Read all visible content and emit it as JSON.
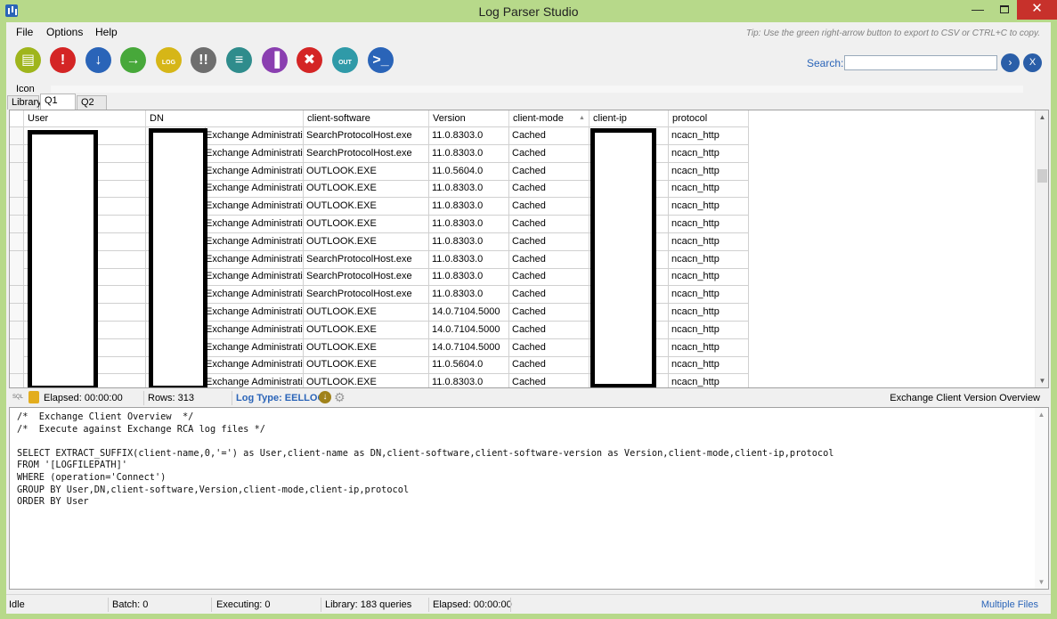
{
  "window": {
    "title": "Log Parser Studio",
    "min_glyph": "—",
    "close_glyph": "✕"
  },
  "menu": {
    "items": [
      "File",
      "Options",
      "Help"
    ],
    "tip": "Tip: Use the green right-arrow button to export to CSV or CTRL+C to copy."
  },
  "toolbar": {
    "buttons": [
      {
        "name": "document-icon",
        "glyph": "▤",
        "color": "#9fb51c"
      },
      {
        "name": "alert-icon",
        "glyph": "!",
        "color": "#d42525"
      },
      {
        "name": "download-icon",
        "glyph": "↓",
        "color": "#2a64b8"
      },
      {
        "name": "export-arrow-icon",
        "glyph": "→",
        "color": "#47a83a"
      },
      {
        "name": "log-icon",
        "glyph": "LOG",
        "color": "#d6b617"
      },
      {
        "name": "double-alert-icon",
        "glyph": "!!",
        "color": "#6e6e6e"
      },
      {
        "name": "page-icon",
        "glyph": "≡",
        "color": "#2f8c8c"
      },
      {
        "name": "chart-icon",
        "glyph": "▐",
        "color": "#8a3fb0"
      },
      {
        "name": "cancel-icon",
        "glyph": "✖",
        "color": "#d42525"
      },
      {
        "name": "out-icon",
        "glyph": "OUT",
        "color": "#2f9aa8"
      },
      {
        "name": "powershell-icon",
        "glyph": ">_",
        "color": "#2a64b8"
      }
    ],
    "icon_label": "Icon",
    "search_label": "Search:",
    "search_value": "",
    "search_go": "›",
    "search_clear": "X"
  },
  "tabs": [
    "Library",
    "Q1",
    "Q2"
  ],
  "grid": {
    "columns": [
      "User",
      "DN",
      "client-software",
      "Version",
      "client-mode",
      "client-ip",
      "protocol"
    ],
    "rows": [
      [
        "",
        "",
        "Exchange Administrati...",
        "SearchProtocolHost.exe",
        "11.0.8303.0",
        "Cached",
        "",
        "ncacn_http"
      ],
      [
        "",
        "",
        "Exchange Administrati...",
        "SearchProtocolHost.exe",
        "11.0.8303.0",
        "Cached",
        "",
        "ncacn_http"
      ],
      [
        "",
        "",
        "Exchange Administrati...",
        "OUTLOOK.EXE",
        "11.0.5604.0",
        "Cached",
        "",
        "ncacn_http"
      ],
      [
        "",
        "",
        "Exchange Administrati...",
        "OUTLOOK.EXE",
        "11.0.8303.0",
        "Cached",
        "",
        "ncacn_http"
      ],
      [
        "",
        "",
        "Exchange Administrati...",
        "OUTLOOK.EXE",
        "11.0.8303.0",
        "Cached",
        "",
        "ncacn_http"
      ],
      [
        "",
        "",
        "Exchange Administrati...",
        "OUTLOOK.EXE",
        "11.0.8303.0",
        "Cached",
        "",
        "ncacn_http"
      ],
      [
        "",
        "",
        "Exchange Administrati...",
        "OUTLOOK.EXE",
        "11.0.8303.0",
        "Cached",
        "",
        "ncacn_http"
      ],
      [
        "",
        "",
        "Exchange Administrati...",
        "SearchProtocolHost.exe",
        "11.0.8303.0",
        "Cached",
        "",
        "ncacn_http"
      ],
      [
        "",
        "",
        "Exchange Administrati...",
        "SearchProtocolHost.exe",
        "11.0.8303.0",
        "Cached",
        "",
        "ncacn_http"
      ],
      [
        "",
        "",
        "Exchange Administrati...",
        "SearchProtocolHost.exe",
        "11.0.8303.0",
        "Cached",
        "",
        "ncacn_http"
      ],
      [
        "",
        "",
        "Exchange Administrati...",
        "OUTLOOK.EXE",
        "14.0.7104.5000",
        "Cached",
        "",
        "ncacn_http"
      ],
      [
        "",
        "",
        "Exchange Administrati...",
        "OUTLOOK.EXE",
        "14.0.7104.5000",
        "Cached",
        "",
        "ncacn_http"
      ],
      [
        "",
        "",
        "Exchange Administrati...",
        "OUTLOOK.EXE",
        "14.0.7104.5000",
        "Cached",
        "",
        "ncacn_http"
      ],
      [
        "",
        "",
        "Exchange Administrati...",
        "OUTLOOK.EXE",
        "11.0.5604.0",
        "Cached",
        "",
        "ncacn_http"
      ],
      [
        "",
        "",
        "Exchange Administrati...",
        "OUTLOOK.EXE",
        "11.0.8303.0",
        "Cached",
        "",
        "ncacn_http"
      ]
    ]
  },
  "query_status": {
    "sql_badge": "SQL",
    "elapsed": "Elapsed: 00:00:00",
    "rows": "Rows: 313",
    "log_type": "Log Type: EELLOG",
    "query_name": "Exchange Client Version Overview"
  },
  "editor": {
    "code": "/*  Exchange Client Overview  */\n/*  Execute against Exchange RCA log files */\n\nSELECT EXTRACT_SUFFIX(client-name,0,'=') as User,client-name as DN,client-software,client-software-version as Version,client-mode,client-ip,protocol\nFROM '[LOGFILEPATH]'\nWHERE (operation='Connect')\nGROUP BY User,DN,client-software,Version,client-mode,client-ip,protocol\nORDER BY User"
  },
  "statusbar": {
    "state": "Idle",
    "batch": "Batch: 0",
    "executing": "Executing: 0",
    "library": "Library: 183 queries",
    "elapsed": "Elapsed: 00:00:00",
    "files": "Multiple Files"
  }
}
